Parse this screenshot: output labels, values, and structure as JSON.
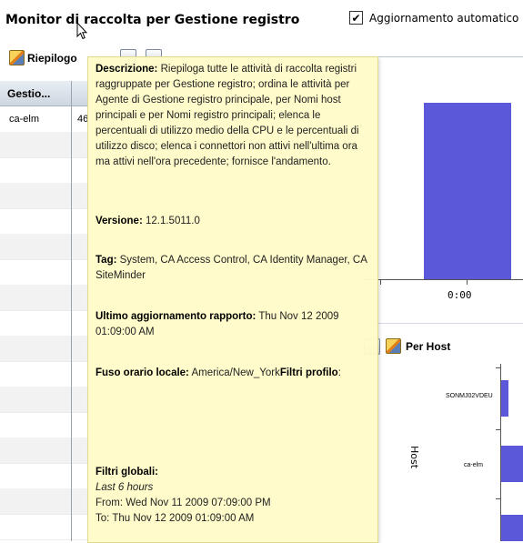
{
  "header": {
    "title": "Monitor di raccolta per Gestione registro",
    "auto_update_label": "Aggiornamento automatico",
    "auto_update_checked": true
  },
  "toolbar": {
    "summary_label": "Riepilogo"
  },
  "grid": {
    "column_header": "Gestio...",
    "rows": [
      {
        "host": "ca-elm",
        "value": "46"
      }
    ]
  },
  "chart_top": {
    "tick_label": "0:00",
    "bar_color": "#5b59d9"
  },
  "panel_per_host": {
    "title": "Per Host",
    "axis_title": "Host",
    "hosts": [
      "SONMJ02VDEU",
      "ca-elm"
    ]
  },
  "tooltip": {
    "description_label": "Descrizione:",
    "description": "Riepiloga tutte le attività di raccolta registri raggruppate per Gestione registro; ordina le attività per Agente di Gestione registro principale, per Nomi host principali e per Nomi registro principali; elenca le percentuali di utilizzo medio della CPU e le percentuali di utilizzo disco; elenca i connettori non attivi nell'ultima ora ma attivi nell'ora precedente; fornisce l'andamento.",
    "version_label": "Versione:",
    "version": "12.1.5011.0",
    "tags_label": "Tag:",
    "tags": "System, CA Access Control, CA Identity Manager, CA SiteMinder",
    "last_update_label": "Ultimo aggiornamento rapporto:",
    "last_update": "Thu Nov 12 2009 01:09:00 AM",
    "timezone_label": "Fuso orario locale:",
    "timezone": "America/New_York",
    "profile_filters_label": "Filtri profilo",
    "profile_filters_colon": ":",
    "global_filters_label": "Filtri globali:",
    "global_range": "Last 6 hours",
    "from": "From: Wed Nov 11 2009 07:09:00 PM",
    "to": "To: Thu Nov 12 2009 01:09:00 AM"
  },
  "icons": {
    "pencil": "pencil-edit-icon",
    "checkbox": "check-icon",
    "cursor": "mouse-pointer-icon"
  }
}
